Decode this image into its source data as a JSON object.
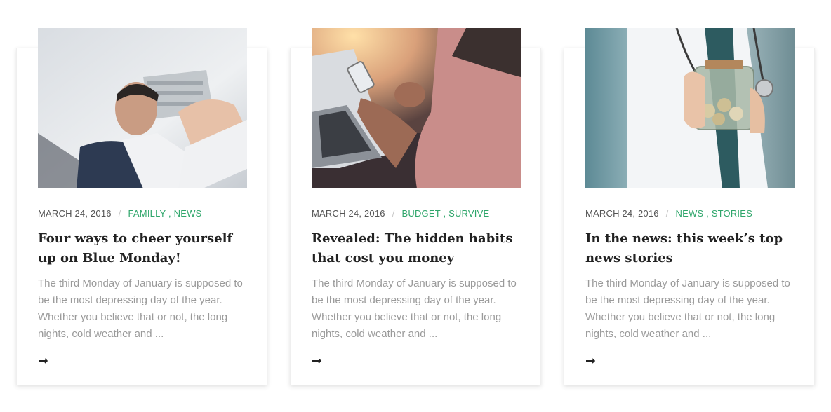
{
  "posts": [
    {
      "image_alt": "Businessman in suit looking up",
      "date": "MARCH 24, 2016",
      "categories": [
        "FAMILLY",
        "NEWS"
      ],
      "title": "Four ways to cheer yourself up on Blue Monday!",
      "excerpt": "The third Monday of January is supposed to be the most depressing day of the year. Whether you believe that or not, the long nights, cold weather and ..."
    },
    {
      "image_alt": "Person using smartphone beside laptop",
      "date": "MARCH 24, 2016",
      "categories": [
        "BUDGET",
        "SURVIVE"
      ],
      "title": "Revealed: The hidden habits that cost you money",
      "excerpt": "The third Monday of January is supposed to be the most depressing day of the year. Whether you believe that or not, the long nights, cold weather and ..."
    },
    {
      "image_alt": "Doctor holding jar of coins",
      "date": "MARCH 24, 2016",
      "categories": [
        "NEWS",
        "STORIES"
      ],
      "title": "In the news: this week’s top news stories",
      "excerpt": "The third Monday of January is supposed to be the most depressing day of the year. Whether you believe that or not, the long nights, cold weather and ..."
    }
  ],
  "meta_separator": "/",
  "category_joiner": " , ",
  "colors": {
    "category": "#2fa66b",
    "title": "#222222",
    "excerpt": "#9a9a9a",
    "date": "#555555"
  },
  "icons": {
    "read_more": "arrow-right-icon"
  }
}
